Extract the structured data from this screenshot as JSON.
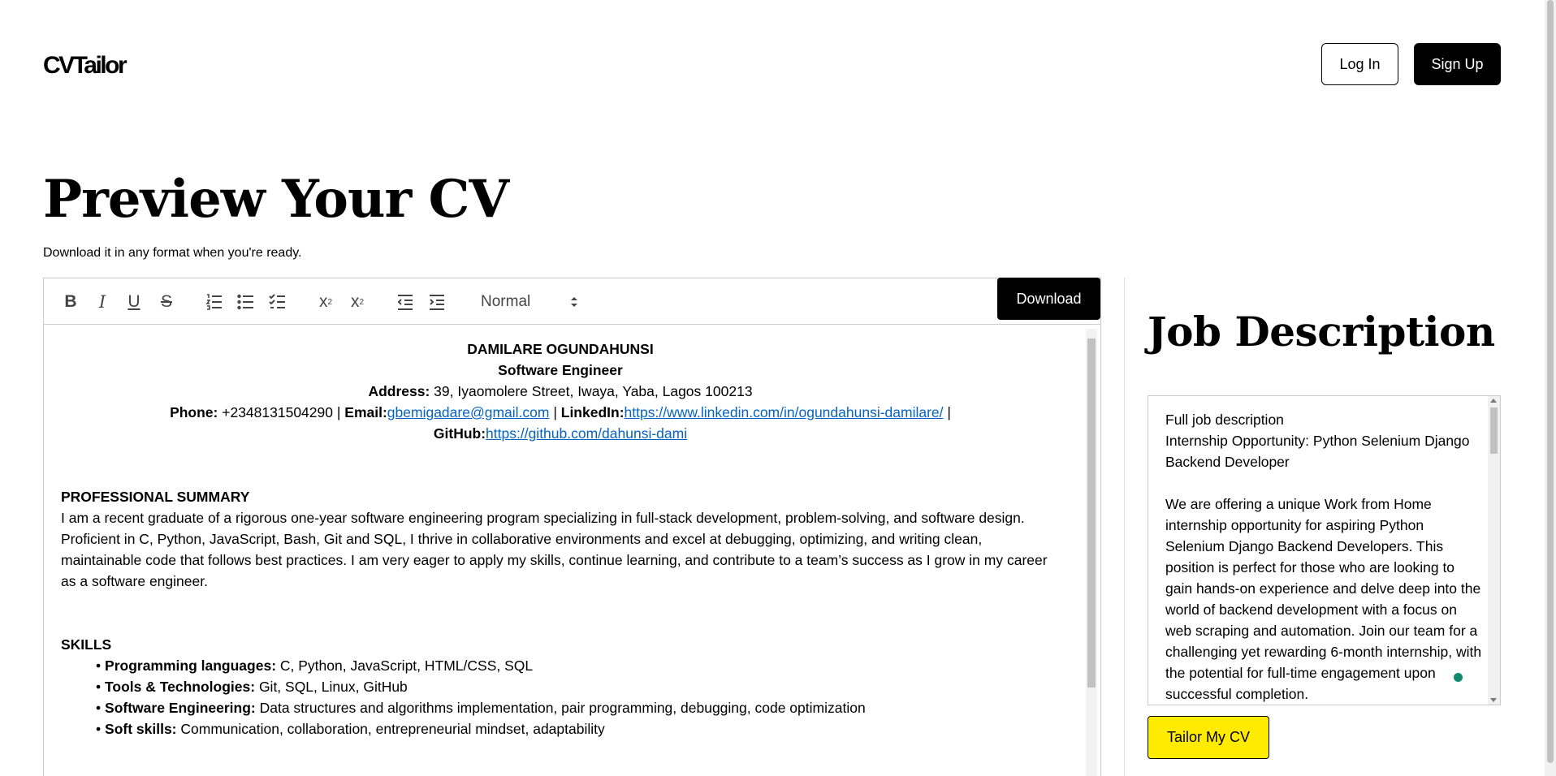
{
  "header": {
    "logo": "CVTailor",
    "login_label": "Log In",
    "signup_label": "Sign Up"
  },
  "page": {
    "title": "Preview Your CV",
    "subtitle": "Download it in any format when you're ready."
  },
  "toolbar": {
    "bold": "B",
    "italic": "I",
    "underline": "U",
    "strike": "S",
    "format_select": "Normal",
    "download_label": "Download",
    "icons": [
      "bold-icon",
      "italic-icon",
      "underline-icon",
      "strikethrough-icon",
      "ordered-list-icon",
      "bullet-list-icon",
      "checklist-icon",
      "subscript-icon",
      "superscript-icon",
      "outdent-icon",
      "indent-icon"
    ]
  },
  "cv": {
    "name": "DAMILARE OGUNDAHUNSI",
    "role": "Software Engineer",
    "address_label": "Address:",
    "address": " 39, Iyaomolere Street, Iwaya, Yaba, Lagos 100213",
    "phone_label": "Phone:",
    "phone": " +2348131504290 | ",
    "email_label": "Email:",
    "email": "gbemigadare@gmail.com",
    "sep1": " | ",
    "linkedin_label": "LinkedIn:",
    "linkedin": "https://www.linkedin.com/in/ogundahunsi-damilare/",
    "sep2": " |",
    "github_label": "GitHub:",
    "github": "https://github.com/dahunsi-dami",
    "summary_heading": "PROFESSIONAL SUMMARY",
    "summary": "I am a recent graduate of a rigorous one-year software engineering program specializing in full-stack development, problem-solving, and software design. Proficient in C, Python, JavaScript, Bash, Git and SQL, I thrive in collaborative environments and excel at debugging, optimizing, and writing clean, maintainable code that follows best practices. I am very eager to apply my skills, continue learning, and contribute to a team’s success as I grow in my career as a software engineer.",
    "skills_heading": "SKILLS",
    "skills": [
      {
        "label": "Programming languages:",
        "value": " C, Python, JavaScript, HTML/CSS, SQL"
      },
      {
        "label": "Tools & Technologies:",
        "value": " Git, SQL, Linux, GitHub"
      },
      {
        "label": "Software Engineering:",
        "value": " Data structures and algorithms implementation, pair programming, debugging, code optimization"
      },
      {
        "label": "Soft skills:",
        "value": " Communication, collaboration, entrepreneurial mindset, adaptability"
      }
    ],
    "bullet": "•"
  },
  "job": {
    "title": "Job Description",
    "text": "Full job description\nInternship Opportunity: Python Selenium Django Backend Developer\n\nWe are offering a unique Work from Home internship opportunity for aspiring Python Selenium Django Backend Developers. This position is perfect for those who are looking to gain hands-on experience and delve deep into the world of backend development with a focus on web scraping and automation. Join our team for a challenging yet rewarding 6-month internship, with the potential for full-time engagement upon successful completion.",
    "tailor_label": "Tailor My CV"
  },
  "colors": {
    "link": "#0563c1",
    "tailor_button": "#ffeb00",
    "primary_button": "#000000",
    "status_dot": "#0f8a6e"
  }
}
